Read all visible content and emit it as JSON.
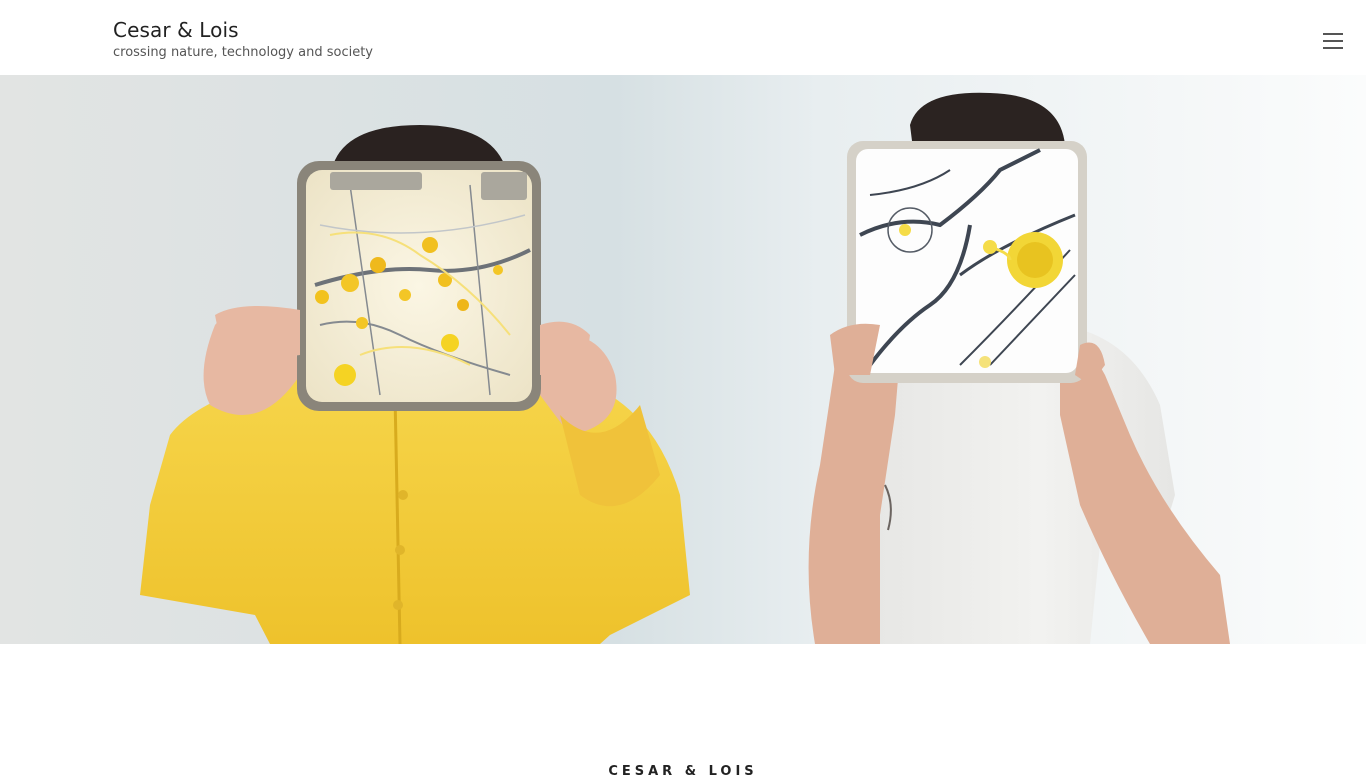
{
  "header": {
    "site_title": "Cesar & Lois",
    "tagline": "crossing nature, technology and society",
    "menu_icon": "hamburger-menu-icon"
  },
  "hero": {
    "image_subject": "two people holding petri-dish maps with yellow slime mold in front of their faces"
  },
  "section": {
    "heading": "CESAR & LOIS"
  },
  "colors": {
    "text_dark": "#222222",
    "text_muted": "#555555",
    "yellow_shirt": "#f2cc3a",
    "white_shirt": "#eeeeee",
    "slime_yellow": "#f5d323"
  }
}
